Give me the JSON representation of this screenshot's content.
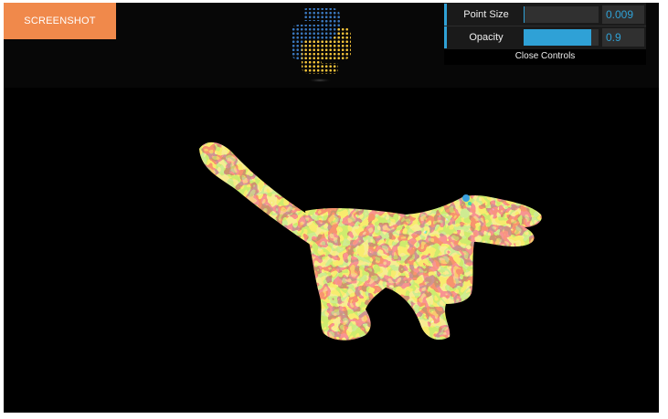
{
  "screenshot_button": {
    "label": "SCREENSHOT"
  },
  "controls": {
    "point_size": {
      "label": "Point Size",
      "value": "0.009",
      "fill_fraction": 0.01
    },
    "opacity": {
      "label": "Opacity",
      "value": "0.9",
      "fill_fraction": 0.9
    },
    "close_label": "Close Controls"
  },
  "colors": {
    "background": "#000000",
    "screenshot_button": "#f0894b",
    "slider_accent": "#2fa1d6",
    "logo_blue": "#3a78c0",
    "logo_yellow": "#f7c53a",
    "point_palette": [
      "#f2d33a",
      "#f39b2a",
      "#e8452a",
      "#9fd54a",
      "#3fd6b0",
      "#3aa0e0"
    ]
  },
  "icons": {
    "logo": "python-logo-icon"
  }
}
